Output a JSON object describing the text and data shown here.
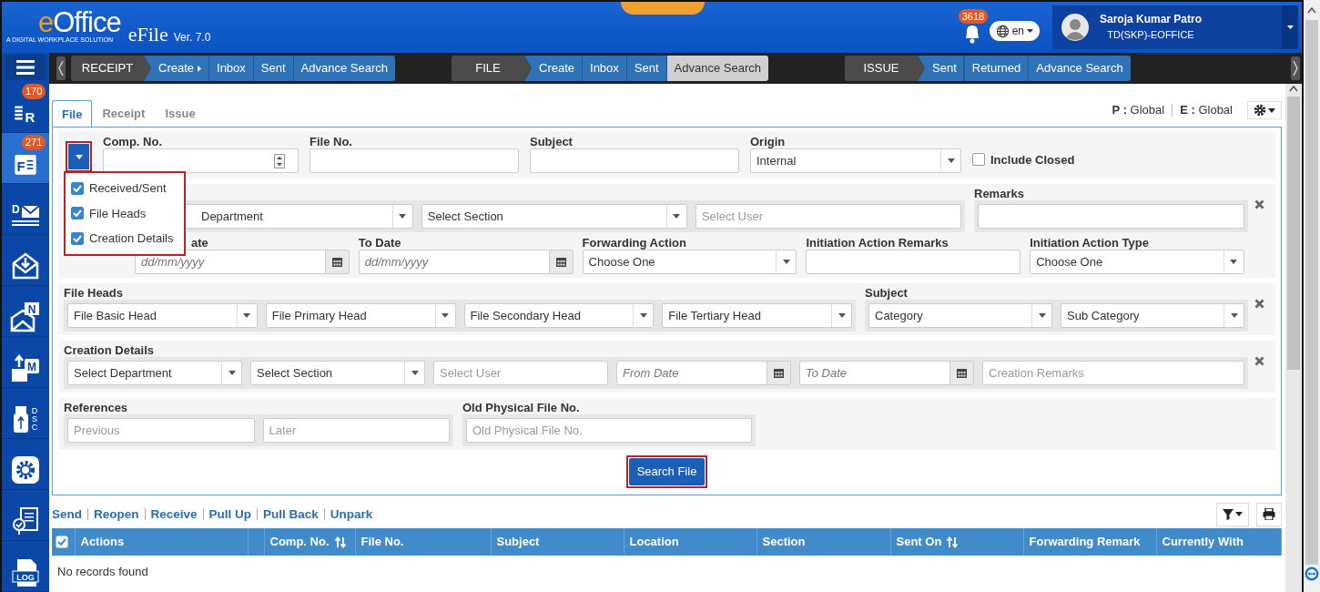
{
  "header": {
    "logo": "eOffice",
    "tagline": "A DIGITAL WORKPLACE SOLUTION",
    "app": "eFile",
    "version": "Ver. 7.0",
    "notifications": "3618",
    "language": "en",
    "user": {
      "name": "Saroja Kumar Patro",
      "role": "TD(SKP)-EOFFICE"
    }
  },
  "sidebar": {
    "items": [
      {
        "kind": "receipt",
        "letter": "R",
        "badge": "170",
        "selected": false
      },
      {
        "kind": "file",
        "letter": "F",
        "badge": "271",
        "selected": true
      },
      {
        "kind": "dak",
        "letter": "D",
        "selected": false
      },
      {
        "kind": "inward",
        "selected": false
      },
      {
        "kind": "notice",
        "letter": "N",
        "selected": false
      },
      {
        "kind": "upload",
        "letter": "M",
        "selected": false
      },
      {
        "kind": "dsc",
        "letter": "DSC",
        "selected": false
      },
      {
        "kind": "settings",
        "selected": false
      },
      {
        "kind": "review",
        "selected": false
      },
      {
        "kind": "log",
        "letter": "LOG",
        "selected": false
      }
    ]
  },
  "navbar": {
    "groups": [
      {
        "title": "RECEIPT",
        "items": [
          {
            "label": "Create",
            "submenu": true,
            "selected": false
          },
          {
            "label": "Inbox",
            "submenu": false,
            "selected": false
          },
          {
            "label": "Sent",
            "submenu": false,
            "selected": false
          },
          {
            "label": "Advance Search",
            "submenu": false,
            "selected": false
          }
        ]
      },
      {
        "title": "FILE",
        "items": [
          {
            "label": "Create",
            "submenu": false,
            "selected": false
          },
          {
            "label": "Inbox",
            "submenu": false,
            "selected": false
          },
          {
            "label": "Sent",
            "submenu": false,
            "selected": false
          },
          {
            "label": "Advance Search",
            "submenu": false,
            "selected": true
          }
        ]
      },
      {
        "title": "ISSUE",
        "items": [
          {
            "label": "Sent",
            "submenu": false,
            "selected": false
          },
          {
            "label": "Returned",
            "submenu": false,
            "selected": false
          },
          {
            "label": "Advance Search",
            "submenu": false,
            "selected": false
          }
        ]
      }
    ]
  },
  "tabs": [
    {
      "label": "File",
      "selected": true
    },
    {
      "label": "Receipt",
      "selected": false
    },
    {
      "label": "Issue",
      "selected": false
    }
  ],
  "scope": [
    "**P :** Global",
    "**E :** Global"
  ],
  "search_form": {
    "column_menu": {
      "expanded": true,
      "items": [
        {
          "label": "Received/Sent",
          "checked": true
        },
        {
          "label": "File Heads",
          "checked": true
        },
        {
          "label": "Creation Details",
          "checked": true
        }
      ]
    },
    "top_fields": [
      {
        "kind": "number",
        "label": "Comp. No."
      },
      {
        "kind": "text",
        "label": "File No."
      },
      {
        "kind": "text",
        "label": "Subject"
      },
      {
        "kind": "select",
        "label": "Origin",
        "value": "Internal"
      }
    ],
    "include_closed": {
      "label": "Include Closed",
      "checked": false
    },
    "sections": [
      {
        "closable": true,
        "groups": [
          {
            "fields": [
              {
                "kind": "select",
                "value": "Department"
              },
              {
                "kind": "select",
                "value": "Select Section"
              },
              {
                "kind": "text",
                "placeholder": "Select User"
              }
            ]
          },
          {
            "label": "Remarks",
            "fields": [
              {
                "kind": "text"
              }
            ]
          }
        ],
        "fields": [
          {
            "kind": "date",
            "label": "ate",
            "placeholder": "dd/mm/yyyy"
          },
          {
            "kind": "date",
            "label": "To Date",
            "placeholder": "dd/mm/yyyy"
          },
          {
            "kind": "select",
            "label": "Forwarding Action",
            "value": "Choose One"
          },
          {
            "kind": "text",
            "label": "Initiation Action Remarks"
          },
          {
            "kind": "select",
            "label": "Initiation Action Type",
            "value": "Choose One"
          }
        ]
      },
      {
        "closable": true,
        "groups": [
          {
            "label": "File Heads",
            "fields": [
              {
                "kind": "select",
                "value": "File Basic Head"
              },
              {
                "kind": "select",
                "value": "File Primary Head"
              },
              {
                "kind": "select",
                "value": "File Secondary Head"
              },
              {
                "kind": "select",
                "value": "File Tertiary Head"
              }
            ]
          },
          {
            "label": "Subject",
            "fields": [
              {
                "kind": "select",
                "value": "Category"
              },
              {
                "kind": "select",
                "value": "Sub Category"
              }
            ]
          }
        ]
      },
      {
        "closable": true,
        "groups": [
          {
            "label": "Creation Details",
            "fields": [
              {
                "kind": "select",
                "value": "Select Department"
              },
              {
                "kind": "select",
                "value": "Select Section"
              },
              {
                "kind": "text",
                "placeholder": "Select User"
              },
              {
                "kind": "date",
                "placeholder": "From Date"
              },
              {
                "kind": "date",
                "placeholder": "To Date"
              },
              {
                "kind": "text",
                "placeholder": "Creation Remarks"
              }
            ]
          }
        ]
      },
      {
        "closable": false,
        "groups": [
          {
            "label": "References",
            "fields": [
              {
                "kind": "text",
                "placeholder": "Previous"
              },
              {
                "kind": "text",
                "placeholder": "Later"
              }
            ]
          },
          {
            "label": "Old Physical File No.",
            "fields": [
              {
                "kind": "text",
                "placeholder": "Old Physical File No."
              }
            ]
          }
        ]
      }
    ],
    "submit": "Search File"
  },
  "actions": [
    "Send",
    "Reopen",
    "Receive",
    "Pull Up",
    "Pull Back",
    "Unpark"
  ],
  "table": {
    "select_all": true,
    "columns": [
      {
        "label": "Actions",
        "sortable": false
      },
      {
        "kind": "spacer"
      },
      {
        "label": "Comp. No.",
        "sortable": true
      },
      {
        "label": "File No.",
        "sortable": false
      },
      {
        "label": "Subject",
        "sortable": false
      },
      {
        "label": "Location",
        "sortable": false
      },
      {
        "label": "Section",
        "sortable": false
      },
      {
        "label": "Sent On",
        "sortable": true
      },
      {
        "label": "Forwarding Remark",
        "sortable": false
      },
      {
        "label": "Currently With",
        "sortable": false
      }
    ],
    "empty_message": "No records found"
  }
}
